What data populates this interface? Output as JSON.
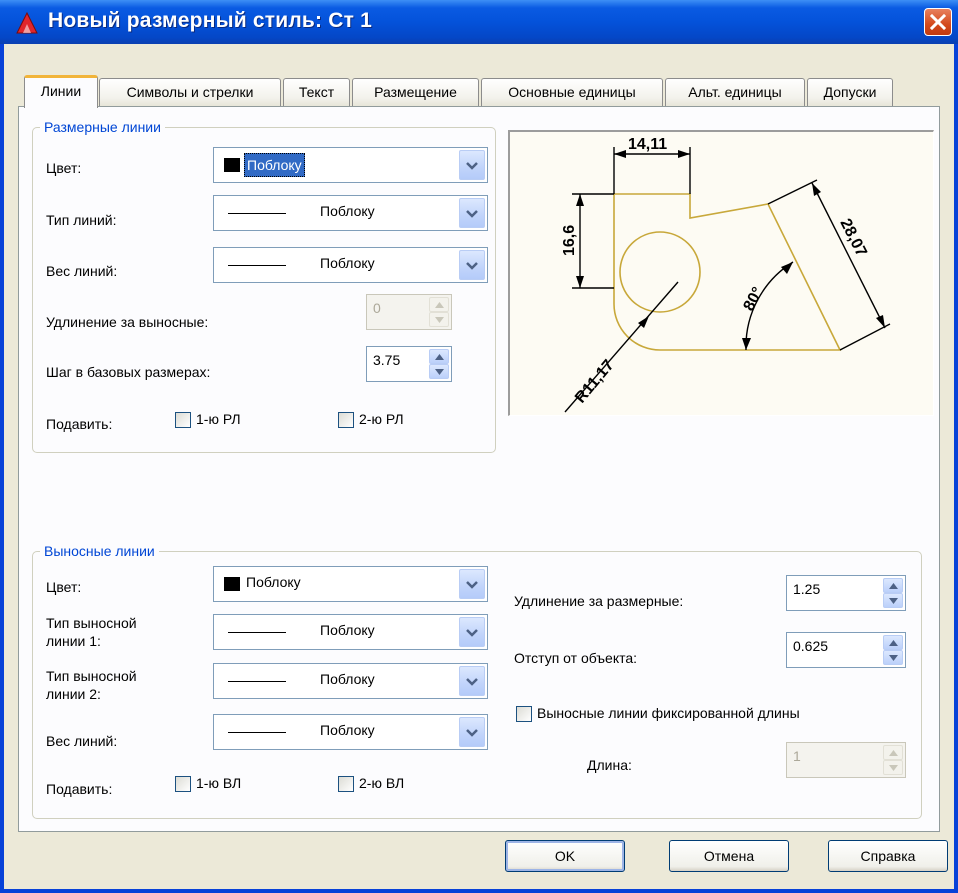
{
  "window": {
    "title": "Новый размерный стиль: Ст 1"
  },
  "tabs": [
    {
      "label": "Линии"
    },
    {
      "label": "Символы и стрелки"
    },
    {
      "label": "Текст"
    },
    {
      "label": "Размещение"
    },
    {
      "label": "Основные единицы"
    },
    {
      "label": "Альт. единицы"
    },
    {
      "label": "Допуски"
    }
  ],
  "dim_lines": {
    "group_label": "Размерные линии",
    "color_label": "Цвет:",
    "color_value": "Поблоку",
    "linetype_label": "Тип линий:",
    "linetype_value": "Поблоку",
    "lineweight_label": "Вес линий:",
    "lineweight_value": "Поблоку",
    "extend_label": "Удлинение за выносные:",
    "extend_value": "0",
    "baseline_label": "Шаг в базовых размерах:",
    "baseline_value": "3.75",
    "suppress_label": "Подавить:",
    "suppress1_label": "1-ю РЛ",
    "suppress2_label": "2-ю РЛ"
  },
  "ext_lines": {
    "group_label": "Выносные линии",
    "color_label": "Цвет:",
    "color_value": "Поблоку",
    "linetype1_label_a": "Тип выносной",
    "linetype1_label_b": "линии 1:",
    "linetype1_value": "Поблоку",
    "linetype2_label_a": "Тип выносной",
    "linetype2_label_b": "линии 2:",
    "linetype2_value": "Поблоку",
    "lineweight_label": "Вес линий:",
    "lineweight_value": "Поблоку",
    "suppress_label": "Подавить:",
    "suppress1_label": "1-ю ВЛ",
    "suppress2_label": "2-ю ВЛ",
    "extend_beyond_label": "Удлинение за размерные:",
    "extend_beyond_value": "1.25",
    "offset_label": "Отступ от объекта:",
    "offset_value": "0.625",
    "fixed_length_label": "Выносные линии фиксированной длины",
    "length_label": "Длина:",
    "length_value": "1"
  },
  "preview": {
    "dim_top": "14,11",
    "dim_left": "16,6",
    "dim_right": "28,07",
    "dim_angle": "80°",
    "dim_radius": "R11,17"
  },
  "buttons": {
    "ok": "OK",
    "cancel": "Отмена",
    "help": "Справка"
  },
  "colors": {
    "title_blue": "#0A5BE3",
    "group_label_blue": "#0046D5",
    "active_tab_accent": "#F1B43A",
    "geometry": "#C8A83A",
    "close_red": "#D3491C"
  }
}
